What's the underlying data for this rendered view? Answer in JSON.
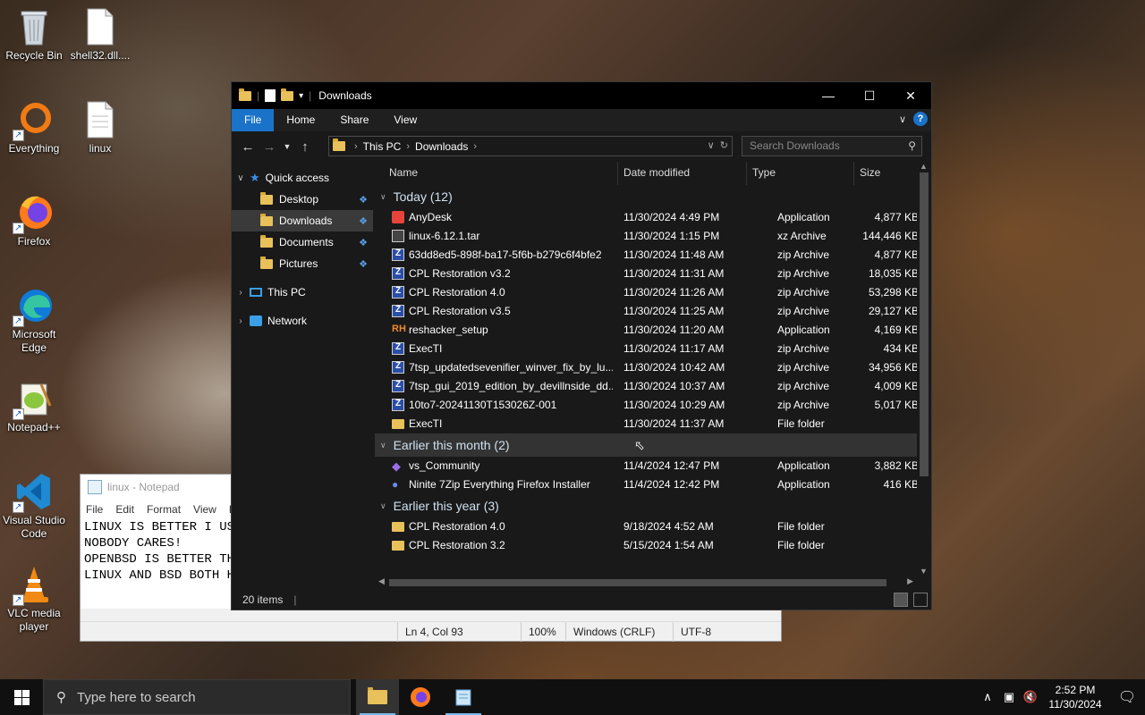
{
  "desktop": {
    "icons": [
      {
        "label": "Recycle Bin",
        "icon": "recycle-bin-icon"
      },
      {
        "label": "shell32.dll....",
        "icon": "file-icon"
      },
      {
        "label": "Everything",
        "icon": "everything-icon"
      },
      {
        "label": "linux",
        "icon": "text-file-icon"
      },
      {
        "label": "Firefox",
        "icon": "firefox-icon"
      },
      {
        "label": "Microsoft Edge",
        "icon": "edge-icon"
      },
      {
        "label": "Notepad++",
        "icon": "notepadpp-icon"
      },
      {
        "label": "Visual Studio Code",
        "icon": "vscode-icon"
      },
      {
        "label": "VLC media player",
        "icon": "vlc-icon"
      }
    ]
  },
  "notepad": {
    "title": "linux - Notepad",
    "menu": [
      "File",
      "Edit",
      "Format",
      "View",
      "H"
    ],
    "lines": [
      "LINUX IS BETTER I USE",
      "NOBODY CARES!",
      "OPENBSD IS BETTER THA",
      "LINUX AND BSD BOTH HA"
    ],
    "status": {
      "position": "Ln 4, Col 93",
      "zoom": "100%",
      "eol": "Windows (CRLF)",
      "encoding": "UTF-8"
    }
  },
  "explorer": {
    "title": "Downloads",
    "ribbon_tabs": {
      "file": "File",
      "home": "Home",
      "share": "Share",
      "view": "View"
    },
    "address": {
      "root": "This PC",
      "current": "Downloads"
    },
    "search_placeholder": "Search Downloads",
    "nav": {
      "quick_access": "Quick access",
      "desktop": "Desktop",
      "downloads": "Downloads",
      "documents": "Documents",
      "pictures": "Pictures",
      "this_pc": "This PC",
      "network": "Network"
    },
    "columns": {
      "name": "Name",
      "date": "Date modified",
      "type": "Type",
      "size": "Size"
    },
    "groups": {
      "today": "Today (12)",
      "earlier_month": "Earlier this month (2)",
      "earlier_year": "Earlier this year (3)"
    },
    "files_today": [
      {
        "name": "AnyDesk",
        "date": "11/30/2024 4:49 PM",
        "type": "Application",
        "size": "4,877 KB",
        "icon": "anydesk-icon"
      },
      {
        "name": "linux-6.12.1.tar",
        "date": "11/30/2024 1:15 PM",
        "type": "xz Archive",
        "size": "144,446 KB",
        "icon": "archive-icon"
      },
      {
        "name": "63dd8ed5-898f-ba17-5f6b-b279c6f4bfe2",
        "date": "11/30/2024 11:48 AM",
        "type": "zip Archive",
        "size": "4,877 KB",
        "icon": "zip-icon"
      },
      {
        "name": "CPL Restoration v3.2",
        "date": "11/30/2024 11:31 AM",
        "type": "zip Archive",
        "size": "18,035 KB",
        "icon": "zip-icon"
      },
      {
        "name": "CPL Restoration 4.0",
        "date": "11/30/2024 11:26 AM",
        "type": "zip Archive",
        "size": "53,298 KB",
        "icon": "zip-icon"
      },
      {
        "name": "CPL Restoration v3.5",
        "date": "11/30/2024 11:25 AM",
        "type": "zip Archive",
        "size": "29,127 KB",
        "icon": "zip-icon"
      },
      {
        "name": "reshacker_setup",
        "date": "11/30/2024 11:20 AM",
        "type": "Application",
        "size": "4,169 KB",
        "icon": "reshacker-icon"
      },
      {
        "name": "ExecTI",
        "date": "11/30/2024 11:17 AM",
        "type": "zip Archive",
        "size": "434 KB",
        "icon": "zip-icon"
      },
      {
        "name": "7tsp_updatedsevenifier_winver_fix_by_lu...",
        "date": "11/30/2024 10:42 AM",
        "type": "zip Archive",
        "size": "34,956 KB",
        "icon": "zip-icon"
      },
      {
        "name": "7tsp_gui_2019_edition_by_devillnside_dd...",
        "date": "11/30/2024 10:37 AM",
        "type": "zip Archive",
        "size": "4,009 KB",
        "icon": "zip-icon"
      },
      {
        "name": "10to7-20241130T153026Z-001",
        "date": "11/30/2024 10:29 AM",
        "type": "zip Archive",
        "size": "5,017 KB",
        "icon": "zip-icon"
      },
      {
        "name": "ExecTI",
        "date": "11/30/2024 11:37 AM",
        "type": "File folder",
        "size": "",
        "icon": "folder-icon"
      }
    ],
    "files_month": [
      {
        "name": "vs_Community",
        "date": "11/4/2024 12:47 PM",
        "type": "Application",
        "size": "3,882 KB",
        "icon": "vs-icon"
      },
      {
        "name": "Ninite 7Zip Everything Firefox Installer",
        "date": "11/4/2024 12:42 PM",
        "type": "Application",
        "size": "416 KB",
        "icon": "ninite-icon"
      }
    ],
    "files_year": [
      {
        "name": "CPL Restoration 4.0",
        "date": "9/18/2024 4:52 AM",
        "type": "File folder",
        "size": "",
        "icon": "folder-icon"
      },
      {
        "name": "CPL Restoration 3.2",
        "date": "5/15/2024 1:54 AM",
        "type": "File folder",
        "size": "",
        "icon": "folder-icon"
      }
    ],
    "status_items": "20 items"
  },
  "taskbar": {
    "search_placeholder": "Type here to search",
    "time": "2:52 PM",
    "date": "11/30/2024"
  }
}
